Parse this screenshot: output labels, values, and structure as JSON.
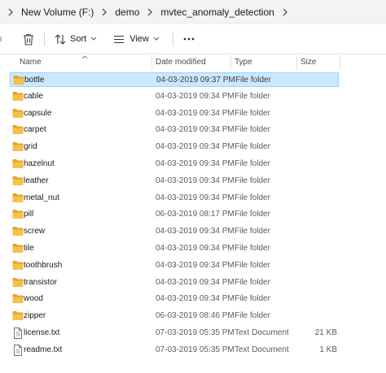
{
  "breadcrumb": {
    "items": [
      "New Volume (F:)",
      "demo",
      "mvtec_anomaly_detection"
    ]
  },
  "toolbar": {
    "delete_icon": "trash-icon",
    "sort_label": "Sort",
    "view_label": "View",
    "more_icon": "ellipsis-icon"
  },
  "columns": {
    "name": "Name",
    "date": "Date modified",
    "type": "Type",
    "size": "Size"
  },
  "colors": {
    "selection_bg": "#cce8ff",
    "selection_border": "#99d1ff",
    "folder": "#f6c04a",
    "folder_dark": "#e0a52b"
  },
  "files": [
    {
      "name": "bottle",
      "date": "04-03-2019 09:37 PM",
      "type": "File folder",
      "size": "",
      "kind": "folder",
      "selected": true
    },
    {
      "name": "cable",
      "date": "04-03-2019 09:34 PM",
      "type": "File folder",
      "size": "",
      "kind": "folder"
    },
    {
      "name": "capsule",
      "date": "04-03-2019 09:34 PM",
      "type": "File folder",
      "size": "",
      "kind": "folder"
    },
    {
      "name": "carpet",
      "date": "04-03-2019 09:34 PM",
      "type": "File folder",
      "size": "",
      "kind": "folder"
    },
    {
      "name": "grid",
      "date": "04-03-2019 09:34 PM",
      "type": "File folder",
      "size": "",
      "kind": "folder"
    },
    {
      "name": "hazelnut",
      "date": "04-03-2019 09:34 PM",
      "type": "File folder",
      "size": "",
      "kind": "folder"
    },
    {
      "name": "leather",
      "date": "04-03-2019 09:34 PM",
      "type": "File folder",
      "size": "",
      "kind": "folder"
    },
    {
      "name": "metal_nut",
      "date": "04-03-2019 09:34 PM",
      "type": "File folder",
      "size": "",
      "kind": "folder"
    },
    {
      "name": "pill",
      "date": "06-03-2019 08:17 PM",
      "type": "File folder",
      "size": "",
      "kind": "folder"
    },
    {
      "name": "screw",
      "date": "04-03-2019 09:34 PM",
      "type": "File folder",
      "size": "",
      "kind": "folder"
    },
    {
      "name": "tile",
      "date": "04-03-2019 09:34 PM",
      "type": "File folder",
      "size": "",
      "kind": "folder"
    },
    {
      "name": "toothbrush",
      "date": "04-03-2019 09:34 PM",
      "type": "File folder",
      "size": "",
      "kind": "folder"
    },
    {
      "name": "transistor",
      "date": "04-03-2019 09:34 PM",
      "type": "File folder",
      "size": "",
      "kind": "folder"
    },
    {
      "name": "wood",
      "date": "04-03-2019 09:34 PM",
      "type": "File folder",
      "size": "",
      "kind": "folder"
    },
    {
      "name": "zipper",
      "date": "06-03-2019 08:46 PM",
      "type": "File folder",
      "size": "",
      "kind": "folder"
    },
    {
      "name": "license.txt",
      "date": "07-03-2019 05:35 PM",
      "type": "Text Document",
      "size": "21 KB",
      "kind": "text"
    },
    {
      "name": "readme.txt",
      "date": "07-03-2019 05:35 PM",
      "type": "Text Document",
      "size": "1 KB",
      "kind": "text"
    }
  ]
}
